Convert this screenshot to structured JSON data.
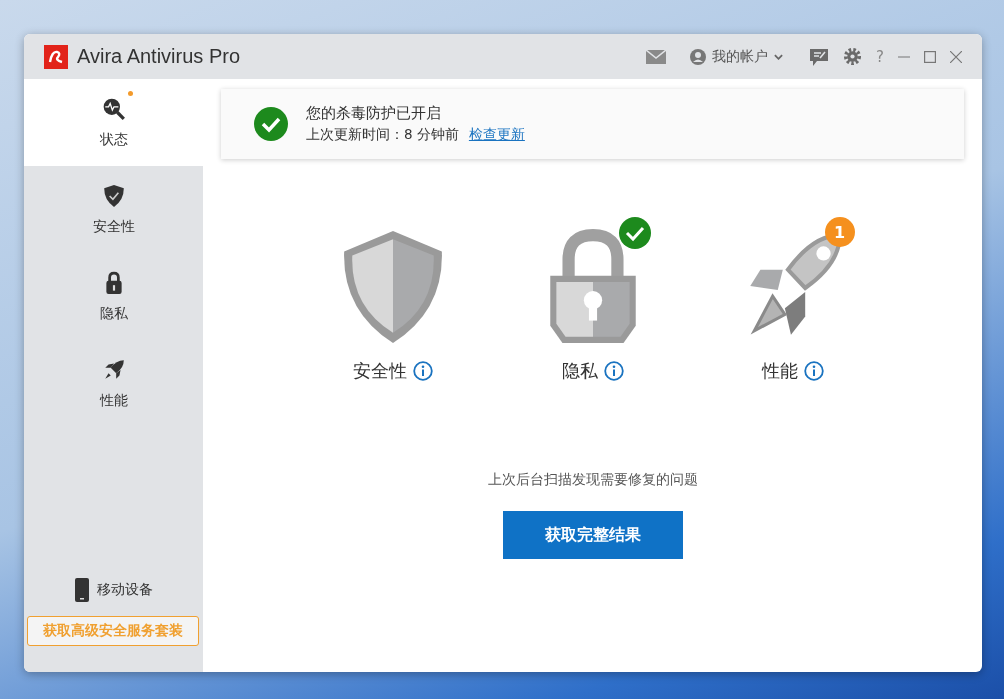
{
  "window": {
    "title": "Avira Antivirus Pro",
    "account": "我的帐户",
    "help": "?"
  },
  "sidebar": {
    "items": [
      {
        "label": "状态",
        "kind": "status",
        "selected": true,
        "notification": true
      },
      {
        "label": "安全性",
        "kind": "security",
        "selected": false,
        "notification": false
      },
      {
        "label": "隐私",
        "kind": "privacy",
        "selected": false,
        "notification": false
      },
      {
        "label": "性能",
        "kind": "performance",
        "selected": false,
        "notification": false
      }
    ],
    "mobile": "移动设备",
    "upgrade": "获取高级安全服务套装"
  },
  "status_banner": {
    "title": "您的杀毒防护已开启",
    "detail": "上次更新时间：8 分钟前",
    "link": "检查更新"
  },
  "features": [
    {
      "label": "安全性",
      "kind": "security"
    },
    {
      "label": "隐私",
      "kind": "privacy",
      "badge": {
        "kind": "check"
      }
    },
    {
      "label": "性能",
      "kind": "performance",
      "badge": {
        "kind": "count",
        "text": "1"
      }
    }
  ],
  "scan_message": "上次后台扫描发现需要修复的问题",
  "result_button": "获取完整结果"
}
